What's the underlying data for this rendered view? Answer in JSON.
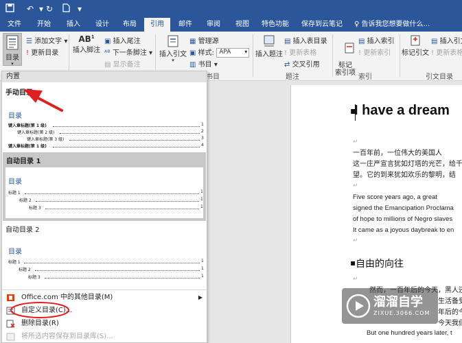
{
  "tabs": [
    "文件",
    "开始",
    "插入",
    "设计",
    "布局",
    "引用",
    "邮件",
    "审阅",
    "视图",
    "特色功能",
    "保存到云笔记"
  ],
  "active_tab": "引用",
  "tell_me": "告诉我您想要做什么...",
  "ribbon": {
    "toc_button": "目录",
    "add_text": "添加文字",
    "update_toc": "更新目录",
    "insert_footnote": "插入脚注",
    "insert_endnote": "插入尾注",
    "next_footnote": "下一条脚注",
    "show_notes": "显示备注",
    "insert_citation": "插入引文",
    "manage_sources": "管理源",
    "style_label": "样式:",
    "style_value": "APA",
    "bibliography": "书目",
    "insert_caption": "插入题注",
    "insert_table_of_figures": "插入表目录",
    "update_table": "更新表格",
    "cross_reference": "交叉引用",
    "mark_entry": "标记\n索引项",
    "insert_index": "插入索引",
    "update_index": "更新索引",
    "mark_citation": "标记引文",
    "insert_toa": "插入引文",
    "update_toa": "更新表格",
    "groups": {
      "citations": "书目",
      "captions": "题注",
      "index": "索引",
      "toa": "引文目录"
    }
  },
  "dropdown": {
    "header": "内置",
    "manual": {
      "title": "手动目录",
      "toc_heading": "目录",
      "lines": [
        {
          "text": "键入章标题(第 1 级)",
          "num": "1"
        },
        {
          "text": "键入章标题(第 2 级)",
          "num": "2"
        },
        {
          "text": "键入章标题(第 3 级)",
          "num": "3"
        },
        {
          "text": "键入章标题(第 1 级)",
          "num": "4"
        }
      ]
    },
    "auto1": {
      "title": "自动目录 1",
      "toc_heading": "目录",
      "lines": [
        {
          "text": "标题 1",
          "num": "1"
        },
        {
          "text": "标题 2",
          "num": "1"
        },
        {
          "text": "标题 3",
          "num": "1"
        }
      ]
    },
    "auto2": {
      "title": "自动目录 2",
      "toc_heading": "目录",
      "lines": [
        {
          "text": "标题 1",
          "num": "1"
        },
        {
          "text": "标题 2",
          "num": "1"
        },
        {
          "text": "标题 3",
          "num": "1"
        }
      ]
    },
    "menu": {
      "office_more": "Office.com 中的其他目录(M)",
      "custom_toc": "自定义目录(C)...",
      "remove_toc": "删除目录(R)",
      "save_selection": "将所选内容保存到目录库(S)..."
    }
  },
  "document": {
    "heading1": "I have a dream",
    "cn_para": "一百年前，一位伟大的美国人\n这一庄严宣言犹如灯塔的光芒，给千\n望。它的到来犹如欢乐的黎明，结",
    "en_para": "Five score years ago, a great\nsigned the Emancipation Proclama\nof hope to millions of Negro slaves\nIt came as a joyous daybreak to en",
    "heading2": "自由的向往",
    "cn_para2": "然而，一百年后的今天，黑人还\n生活备受\n年后的今\n今天我们",
    "en_last": "But one hundred years later, t"
  },
  "watermark": {
    "brand": "溜溜自学",
    "url": "ZIXUE.3066.COM"
  },
  "colors": {
    "word_blue": "#2b579a",
    "annotation_red": "#e02020"
  }
}
